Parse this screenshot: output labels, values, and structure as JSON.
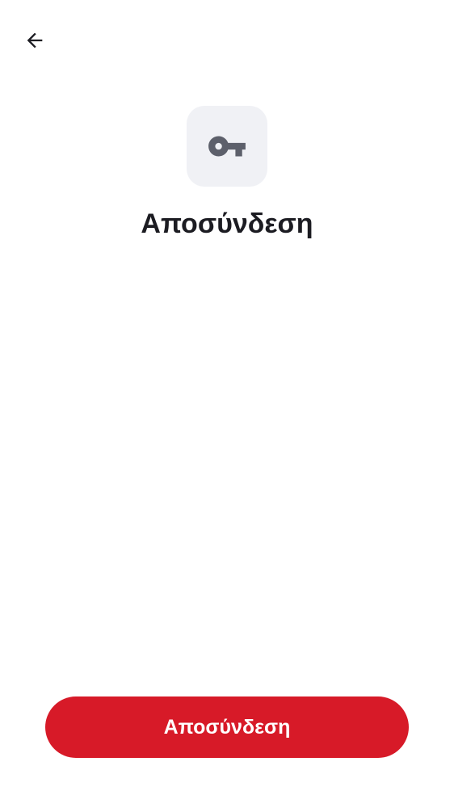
{
  "header": {
    "back_icon": "arrow-left-icon"
  },
  "hero": {
    "icon": "key-icon",
    "icon_color": "#5d606b",
    "tile_color": "#f0f1f5",
    "title": "Αποσύνδεση"
  },
  "actions": {
    "logout_label": "Αποσύνδεση",
    "button_color": "#d71a28"
  }
}
